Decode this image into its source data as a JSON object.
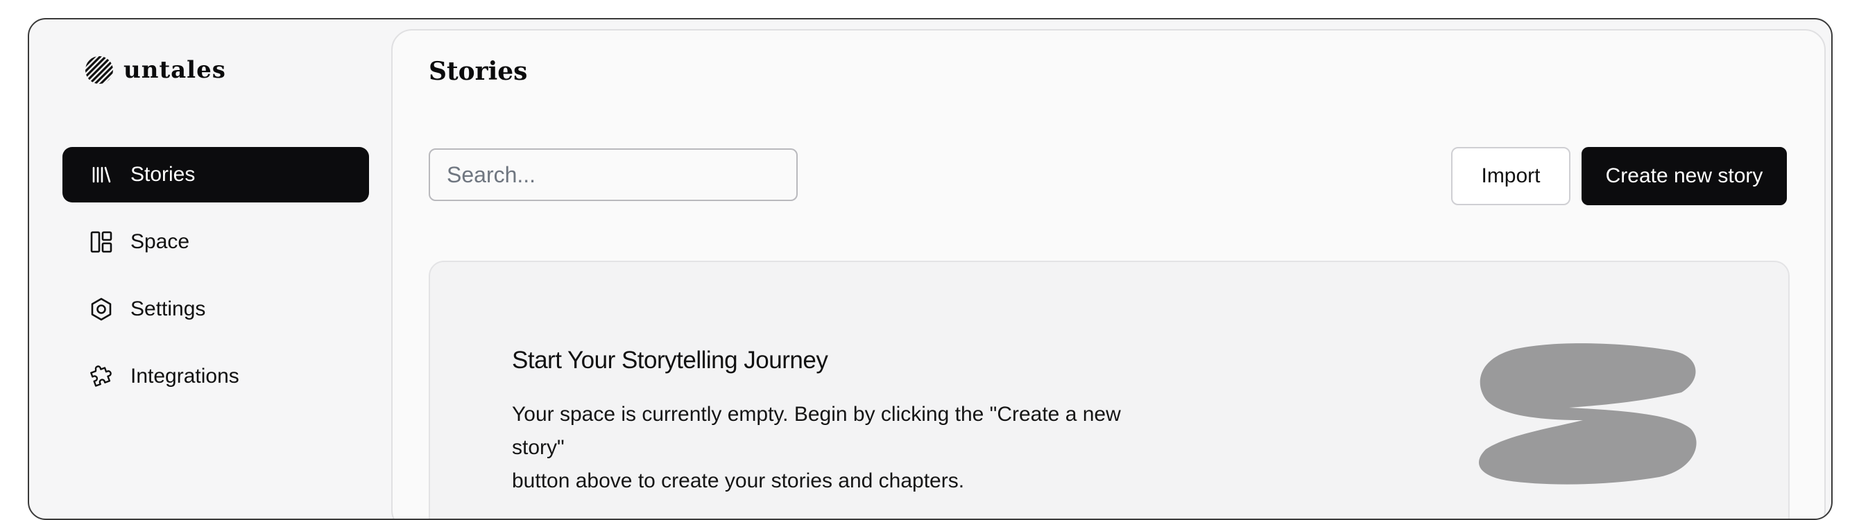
{
  "app": {
    "name": "untales"
  },
  "sidebar": {
    "items": [
      {
        "label": "Stories",
        "icon": "library-icon",
        "active": true
      },
      {
        "label": "Space",
        "icon": "layout-icon",
        "active": false
      },
      {
        "label": "Settings",
        "icon": "settings-hexagon-icon",
        "active": false
      },
      {
        "label": "Integrations",
        "icon": "puzzle-icon",
        "active": false
      }
    ]
  },
  "main": {
    "title": "Stories",
    "search": {
      "placeholder": "Search...",
      "value": ""
    },
    "import_label": "Import",
    "create_label": "Create new story",
    "empty_state": {
      "title": "Start Your Storytelling Journey",
      "line1": "Your space is currently empty. Begin by clicking the \"Create a new story\"",
      "line2": "button above to create your stories and chapters."
    }
  },
  "colors": {
    "accent": "#0c0c0e",
    "panel_bg": "#fafafa",
    "card_bg": "#f3f3f4",
    "illustration": "#9a9a9b"
  }
}
